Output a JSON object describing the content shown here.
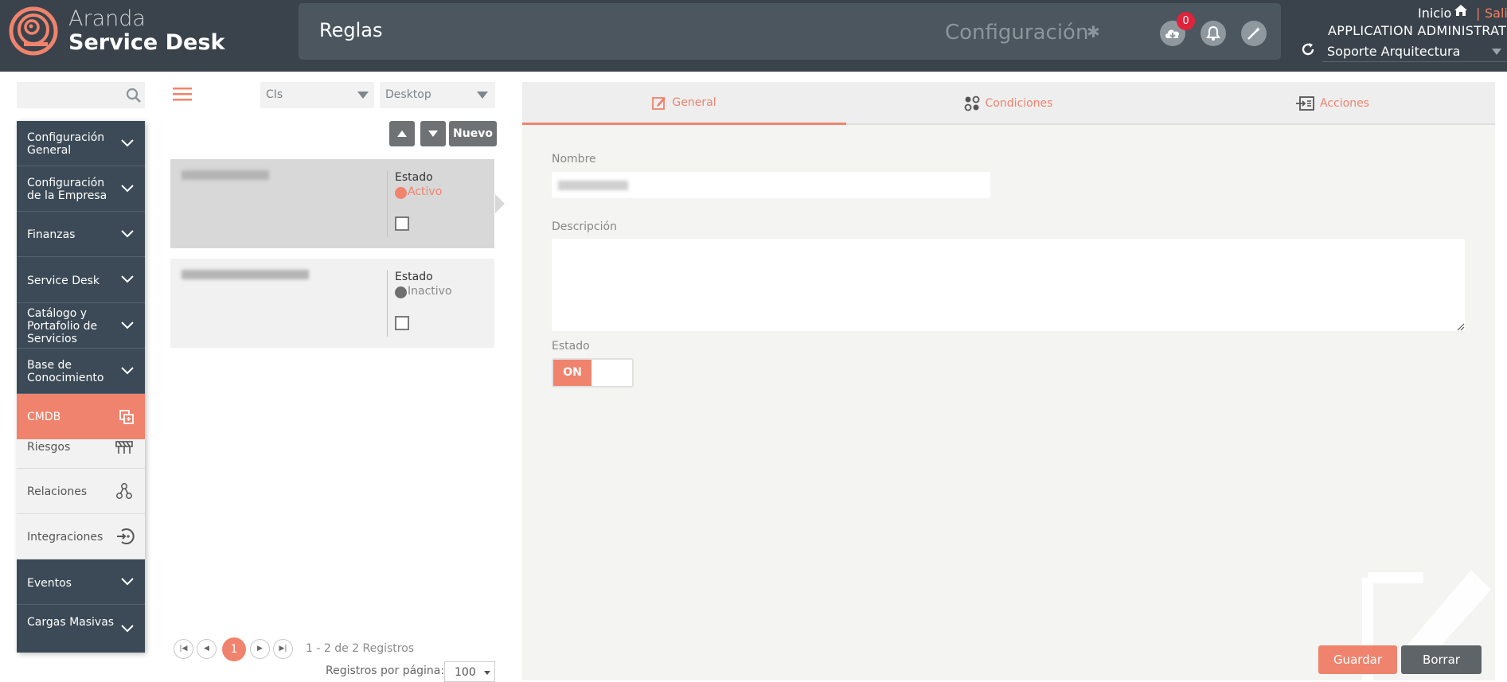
{
  "header": {
    "brand_line1": "Aranda",
    "brand_line2": "Service Desk",
    "page_title": "Reglas",
    "config_label": "Configuración",
    "notifications_count": "0",
    "inicio_label": "Inicio",
    "separator": "|",
    "salir_label": "Salir",
    "user_name": "APPLICATION ADMINISTRATOR",
    "project_selected": "Soporte Arquitectura"
  },
  "menu": {
    "search_placeholder": "",
    "items": [
      {
        "label": "Configuración General"
      },
      {
        "label": "Configuración de la Empresa"
      },
      {
        "label": "Finanzas"
      },
      {
        "label": "Service Desk"
      },
      {
        "label": "Catálogo y Portafolio de Servicios"
      },
      {
        "label": "Base de Conocimiento"
      },
      {
        "label": "CMDB"
      },
      {
        "label": "Eventos"
      },
      {
        "label": "Cargas Masivas"
      }
    ],
    "cmdb_subitems": [
      {
        "label": "Riesgos",
        "icon": "barrier-icon"
      },
      {
        "label": "Relaciones",
        "icon": "relations-icon"
      },
      {
        "label": "Integraciones",
        "icon": "integrations-icon"
      }
    ]
  },
  "list": {
    "filter_type": "CIs",
    "filter_category": "Desktop",
    "new_button": "Nuevo",
    "rules": [
      {
        "estado_label": "Estado",
        "estado_value": "Activo",
        "estado_color": "#f0836d"
      },
      {
        "estado_label": "Estado",
        "estado_value": "Inactivo",
        "estado_color": "#6f6f6f"
      }
    ],
    "pager": {
      "current_page": "1",
      "summary": "1 - 2 de 2 Registros",
      "per_page_label": "Registros por página:",
      "per_page_value": "100"
    }
  },
  "detail": {
    "tabs": [
      {
        "label": "General"
      },
      {
        "label": "Condiciones"
      },
      {
        "label": "Acciones"
      }
    ],
    "nombre_label": "Nombre",
    "descripcion_label": "Descripción",
    "estado_label": "Estado",
    "toggle_on_label": "ON",
    "save_button": "Guardar",
    "delete_button": "Borrar"
  },
  "colors": {
    "accent": "#f0836d",
    "header_bg": "#3a434b",
    "menu_bg": "#3b4a56",
    "badge": "#e0233b"
  }
}
